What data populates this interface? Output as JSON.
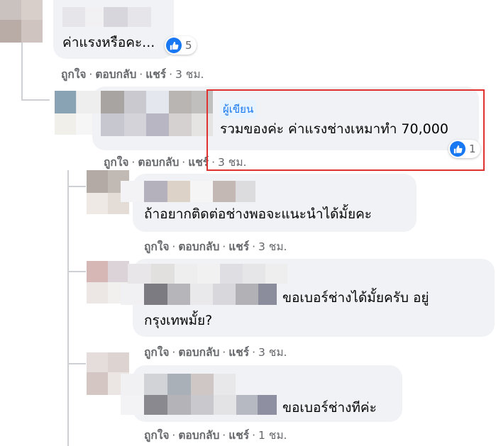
{
  "comments": [
    {
      "text": "ค่าแรงหรือคะ...",
      "likes": "5",
      "actions": {
        "like": "ถูกใจ",
        "reply": "ตอบกลับ",
        "share": "แชร์",
        "time": "3 ชม."
      }
    },
    {
      "author_badge": "ผู้เขียน",
      "text": "รวมของค่ะ ค่าแรงช่างเหมาทำ 70,000",
      "likes": "1",
      "actions": {
        "like": "ถูกใจ",
        "reply": "ตอบกลับ",
        "share": "แชร์",
        "time": "3 ชม."
      }
    },
    {
      "text": "ถ้าอยากติดต่อช่างพอจะแนะนำได้มั้ยคะ",
      "actions": {
        "like": "ถูกใจ",
        "reply": "ตอบกลับ",
        "share": "แชร์",
        "time": "3 ชม."
      }
    },
    {
      "text_line1": "ขอเบอร์ช่างได้มั้ยครับ อยู่",
      "text_line2": "กรุงเทพมั้ย?",
      "actions": {
        "like": "ถูกใจ",
        "reply": "ตอบกลับ",
        "share": "แชร์",
        "time": "3 ชม."
      }
    },
    {
      "text": "ขอเบอร์ช่างทีค่ะ",
      "actions": {
        "like": "ถูกใจ",
        "reply": "ตอบกลับ",
        "share": "แชร์",
        "time": "1 ชม."
      }
    }
  ],
  "colors": {
    "highlight": "#e03131",
    "like_blue": "#1877f2",
    "bubble": "#f0f2f5"
  },
  "icons": {
    "like": "thumbs-up-icon"
  }
}
